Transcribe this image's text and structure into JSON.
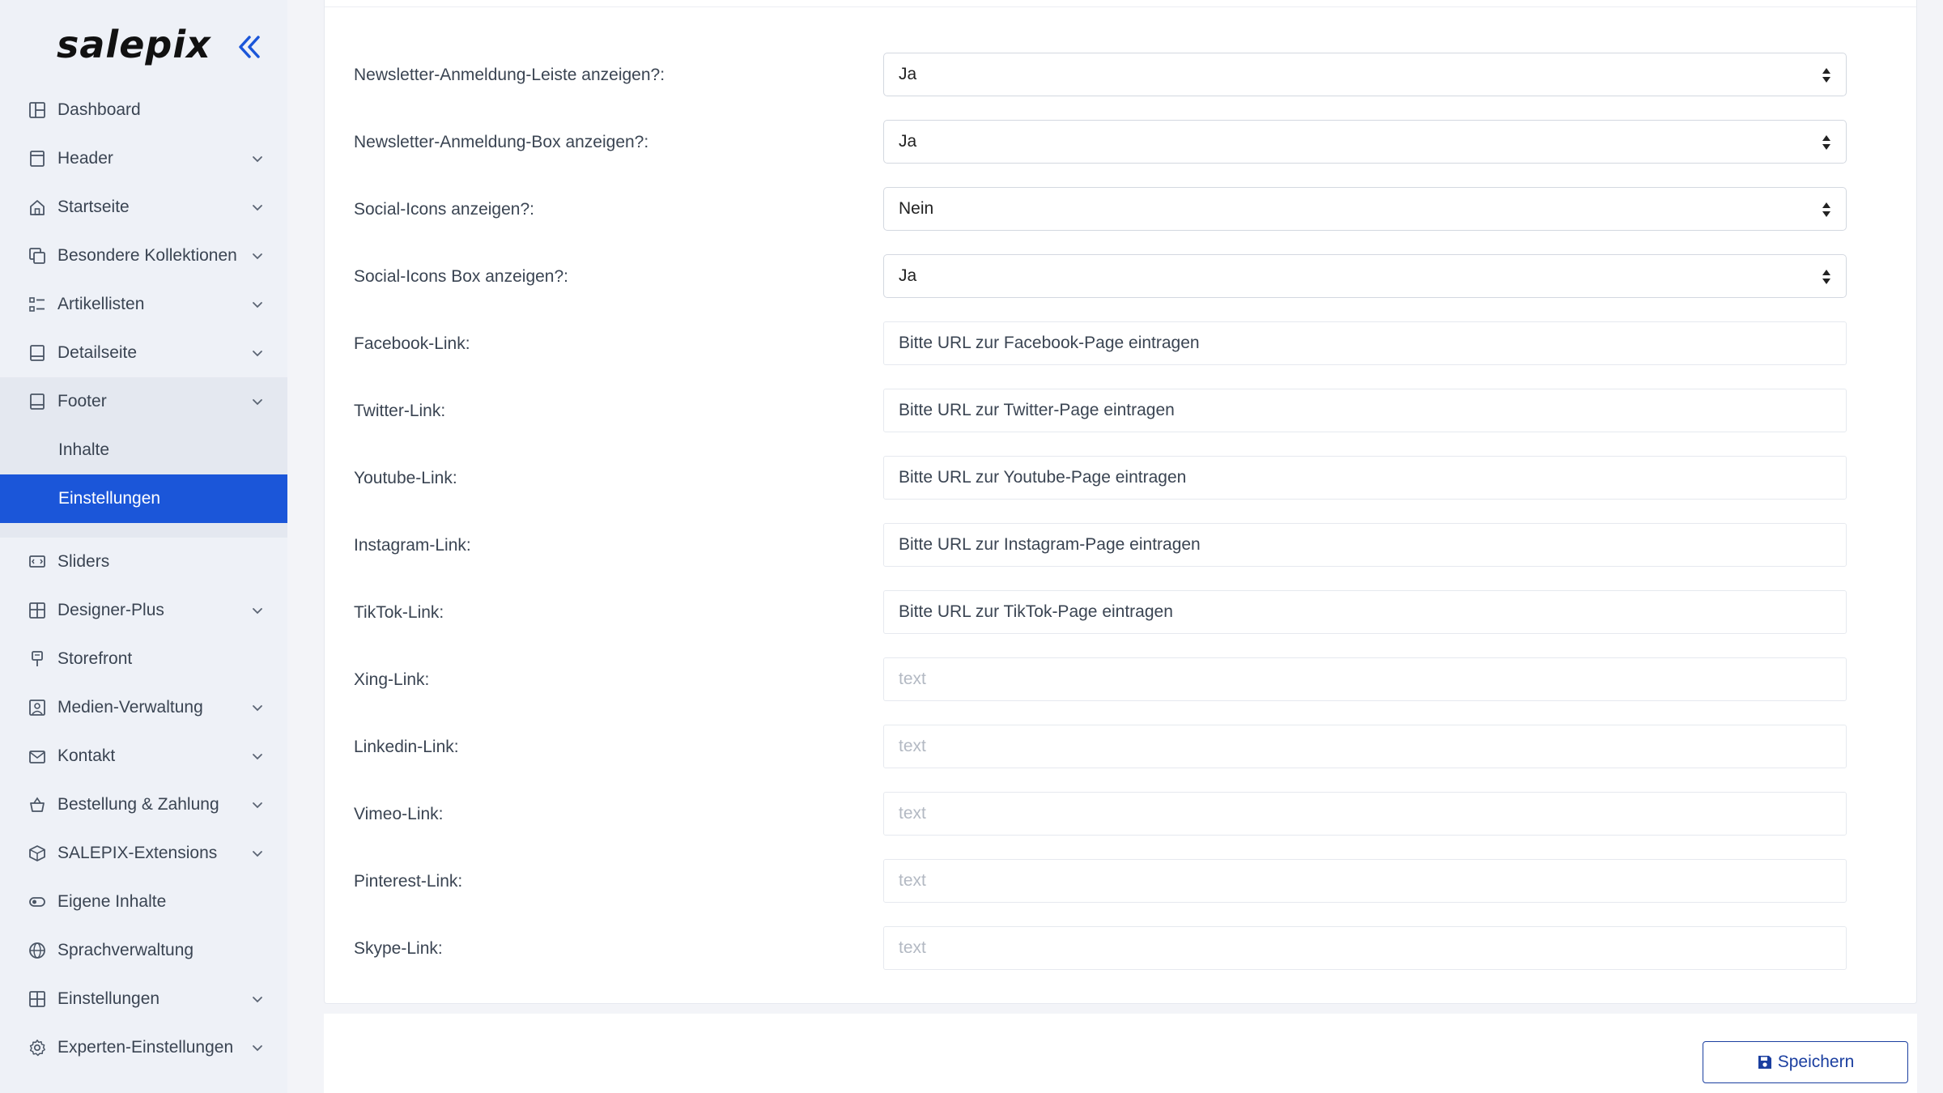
{
  "brand": {
    "logo_text": "salepix"
  },
  "sidebar": {
    "items": [
      {
        "label": "Dashboard",
        "icon": "dashboard-icon",
        "chevron": false
      },
      {
        "label": "Header",
        "icon": "header-icon",
        "chevron": true
      },
      {
        "label": "Startseite",
        "icon": "home-icon",
        "chevron": true
      },
      {
        "label": "Besondere Kollektionen",
        "icon": "collections-icon",
        "chevron": true
      },
      {
        "label": "Artikellisten",
        "icon": "list-icon",
        "chevron": true
      },
      {
        "label": "Detailseite",
        "icon": "detail-icon",
        "chevron": true
      },
      {
        "label": "Footer",
        "icon": "footer-icon",
        "chevron": true,
        "expanded": true
      },
      {
        "label": "Sliders",
        "icon": "slider-icon",
        "chevron": false
      },
      {
        "label": "Designer-Plus",
        "icon": "designer-icon",
        "chevron": true
      },
      {
        "label": "Storefront",
        "icon": "storefront-icon",
        "chevron": false
      },
      {
        "label": "Medien-Verwaltung",
        "icon": "media-icon",
        "chevron": true
      },
      {
        "label": "Kontakt",
        "icon": "contact-icon",
        "chevron": true
      },
      {
        "label": "Bestellung & Zahlung",
        "icon": "basket-icon",
        "chevron": true
      },
      {
        "label": "SALEPIX-Extensions",
        "icon": "extension-icon",
        "chevron": true
      },
      {
        "label": "Eigene Inhalte",
        "icon": "toggle-icon",
        "chevron": false
      },
      {
        "label": "Sprachverwaltung",
        "icon": "globe-icon",
        "chevron": false
      },
      {
        "label": "Einstellungen",
        "icon": "settings-grid-icon",
        "chevron": true
      },
      {
        "label": "Experten-Einstellungen",
        "icon": "gear-icon",
        "chevron": true
      }
    ],
    "footer_sub": [
      {
        "label": "Inhalte",
        "active": false
      },
      {
        "label": "Einstellungen",
        "active": true
      }
    ],
    "accent_color": "#1b56d9"
  },
  "form": {
    "selects": [
      {
        "label": "Newsletter-Anmeldung-Leiste anzeigen?:",
        "value": "Ja"
      },
      {
        "label": "Newsletter-Anmeldung-Box anzeigen?:",
        "value": "Ja"
      },
      {
        "label": "Social-Icons anzeigen?:",
        "value": "Nein"
      },
      {
        "label": "Social-Icons Box anzeigen?:",
        "value": "Ja"
      }
    ],
    "inputs": [
      {
        "label": "Facebook-Link:",
        "placeholder": "Bitte URL zur Facebook-Page eintragen",
        "value": ""
      },
      {
        "label": "Twitter-Link:",
        "placeholder": "Bitte URL zur Twitter-Page eintragen",
        "value": ""
      },
      {
        "label": "Youtube-Link:",
        "placeholder": "Bitte URL zur Youtube-Page eintragen",
        "value": ""
      },
      {
        "label": "Instagram-Link:",
        "placeholder": "Bitte URL zur Instagram-Page eintragen",
        "value": ""
      },
      {
        "label": "TikTok-Link:",
        "placeholder": "Bitte URL zur TikTok-Page eintragen",
        "value": ""
      },
      {
        "label": "Xing-Link:",
        "placeholder": "text",
        "value": ""
      },
      {
        "label": "Linkedin-Link:",
        "placeholder": "text",
        "value": ""
      },
      {
        "label": "Vimeo-Link:",
        "placeholder": "text",
        "value": ""
      },
      {
        "label": "Pinterest-Link:",
        "placeholder": "text",
        "value": ""
      },
      {
        "label": "Skype-Link:",
        "placeholder": "text",
        "value": ""
      }
    ]
  },
  "actions": {
    "save_label": "Speichern",
    "save_icon": "floppy-disk-icon"
  }
}
